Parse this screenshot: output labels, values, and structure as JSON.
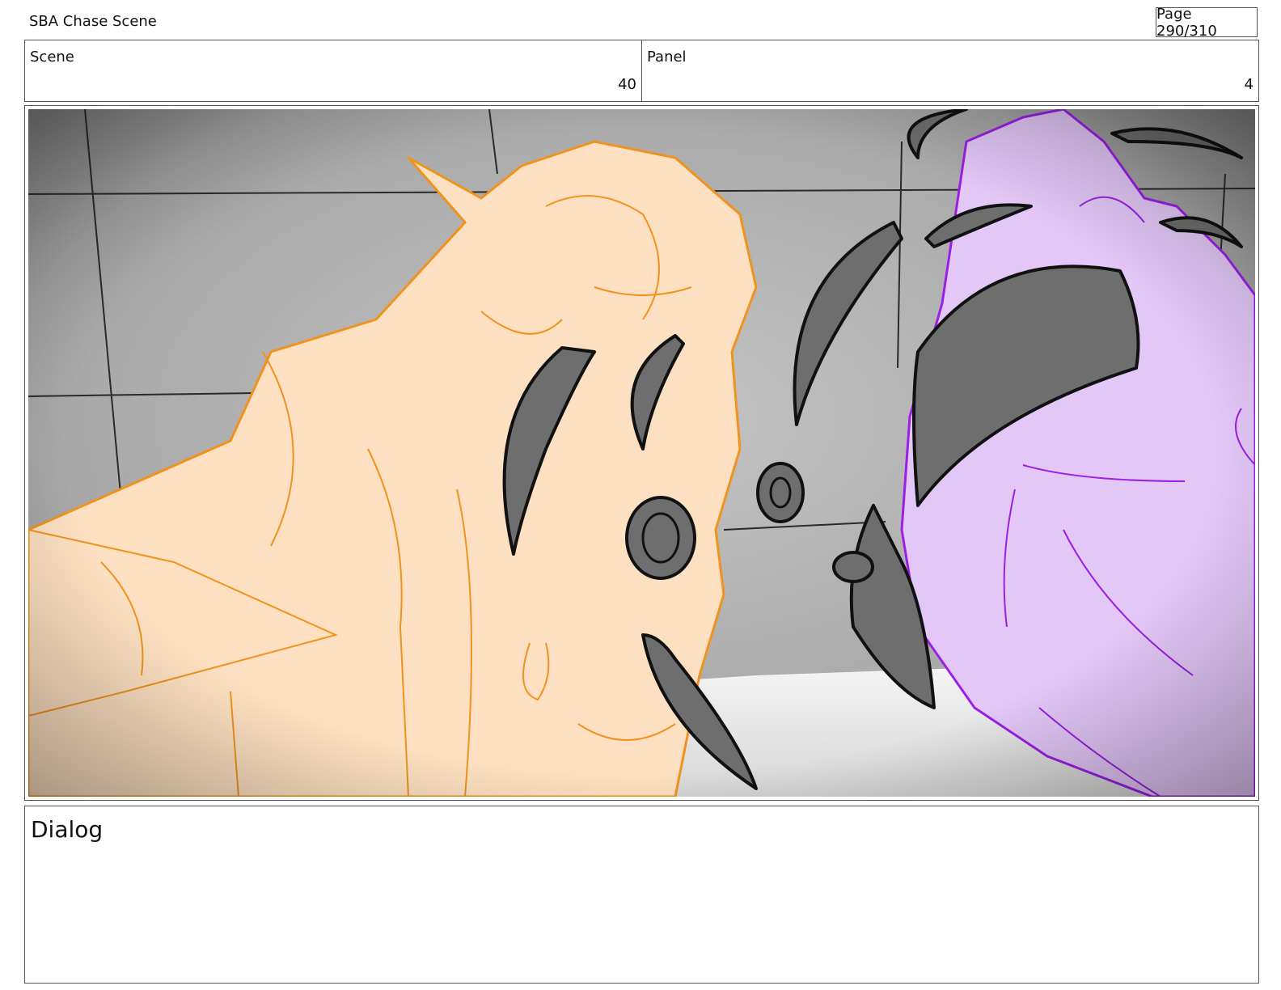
{
  "header": {
    "project_title": "SBA Chase Scene",
    "page": "Page 290/310"
  },
  "info": {
    "scene_label": "Scene",
    "scene_value": "40",
    "panel_label": "Panel",
    "panel_value": "4"
  },
  "dialog": {
    "label": "Dialog",
    "text": ""
  },
  "colors": {
    "sketch_orange": "#f0931e",
    "sketch_orange_fill": "#fde0c1",
    "sketch_purple": "#9b1fe6",
    "sketch_purple_fill": "#e3c7f7",
    "shadow_gray": "#6e6e6e",
    "background_gray": "#a9a9a9"
  }
}
